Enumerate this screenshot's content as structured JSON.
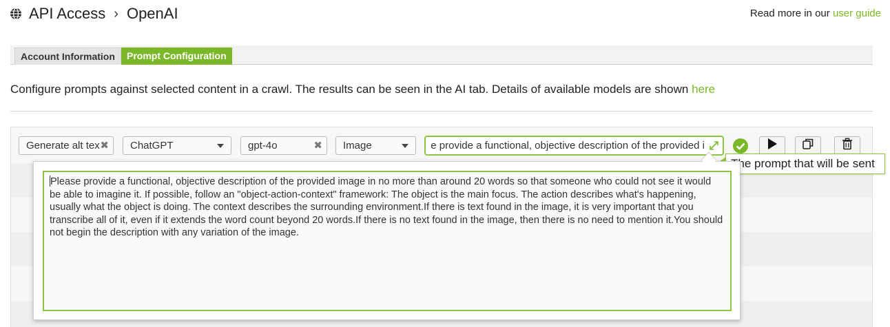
{
  "header": {
    "title": "API Access",
    "breadcrumb_sep": "›",
    "subtitle": "OpenAI",
    "read_more_prefix": "Read more in our",
    "read_more_link": "user guide"
  },
  "tabs": [
    {
      "label": "Account Information",
      "active": false
    },
    {
      "label": "Prompt Configuration",
      "active": true
    }
  ],
  "description": {
    "text": "Configure prompts against selected content in a crawl. The results can be seen in the AI tab. Details of available models are shown",
    "link": "here"
  },
  "row": {
    "name_value": "Generate alt tex",
    "provider_value": "ChatGPT",
    "model_value": "gpt-4o",
    "content_type_value": "Image",
    "prompt_preview": "e provide a functional, objective description of the provided i"
  },
  "tooltip": "The prompt that will be sent",
  "prompt_full": "Please provide a functional, objective description of the provided image in no more than around 20 words so that someone who could not see it would be able to imagine it. If possible, follow an \"object-action-context\" framework: The object is the main focus. The action describes what's happening, usually what the object is doing. The context describes the surrounding environment.If there is text found in the image, it is very important that you transcribe all of it, even if it extends the word count beyond 20 words.If there is no text found in the image, then there is no need to mention it.You should not begin the description with any variation of the image.",
  "icons": {
    "globe": "globe-icon",
    "clear": "clear-icon",
    "dropdown": "chevron-down-icon",
    "expand": "expand-icon",
    "valid": "check-circle-icon",
    "run": "play-icon",
    "duplicate": "copy-icon",
    "delete": "trash-icon"
  },
  "colors": {
    "accent": "#7ab829",
    "border_active": "#8cc63f"
  }
}
